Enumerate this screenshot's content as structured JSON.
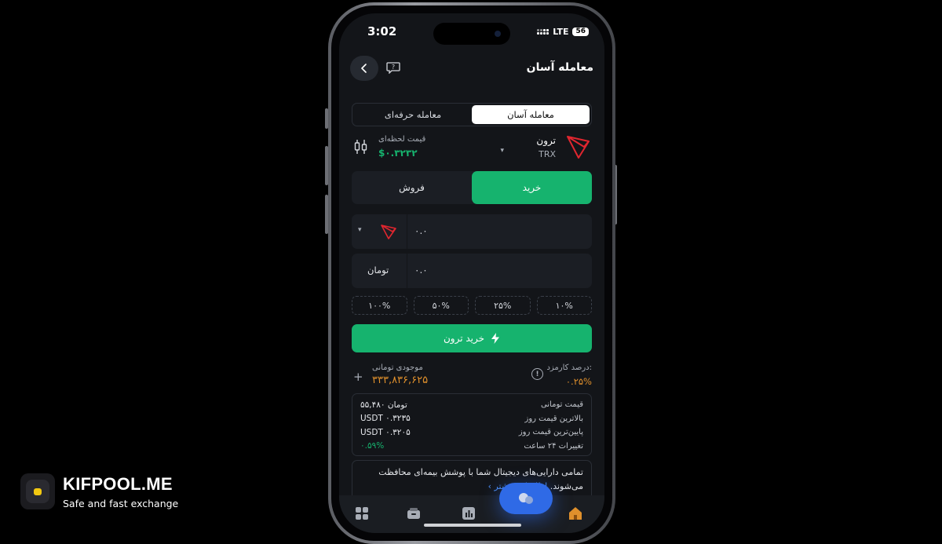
{
  "brand": {
    "name": "KIFPOOL.ME",
    "tagline": "Safe and fast exchange"
  },
  "status_bar": {
    "time": "3:02",
    "network": "LTE",
    "battery": "56"
  },
  "header": {
    "title": "معامله آسان"
  },
  "mode_tabs": [
    {
      "label": "معامله آسان",
      "active": true
    },
    {
      "label": "معامله حرفه‌ای",
      "active": false
    }
  ],
  "coin": {
    "name": "ترون",
    "symbol": "TRX",
    "price_label": "قیمت لحظه‌ای",
    "price": "$۰.۳۲۳۲"
  },
  "trade_side": {
    "buy": "خرید",
    "sell": "فروش",
    "active": "buy"
  },
  "amount_field": {
    "value": "۰.۰"
  },
  "toman_field": {
    "value": "۰.۰",
    "unit": "تومان"
  },
  "percent_buttons": [
    "۱۰%",
    "۲۵%",
    "۵۰%",
    "۱۰۰%"
  ],
  "buy_button": {
    "label": "خرید ترون"
  },
  "fee": {
    "label": "درصد کارمزد:",
    "value": "۰.۲۵%"
  },
  "balance": {
    "label": "موجودی تومانی",
    "value": "۳۳۳,۸۳۶,۶۲۵"
  },
  "stats": [
    {
      "label": "قیمت تومانی",
      "value": "۵۵,۴۸۰ تومان"
    },
    {
      "label": "بالاترین قیمت روز",
      "value": "USDT ۰.۳۲۳۵"
    },
    {
      "label": "پایین‌ترین قیمت روز",
      "value": "USDT ۰.۳۲۰۵"
    },
    {
      "label": "تغییرات ۲۴ ساعت",
      "value": "۰.۵۹%"
    }
  ],
  "insurance": {
    "text": "تمامی دارایی‌های دیجیتال شما با پوشش بیمه‌ای محافظت می‌شوند.",
    "link": "اطلاعات بیشتر ›"
  },
  "colors": {
    "accent": "#16b36e",
    "fee": "#e0902c",
    "tron": "#e0262f",
    "fab": "#2f6ae6"
  }
}
